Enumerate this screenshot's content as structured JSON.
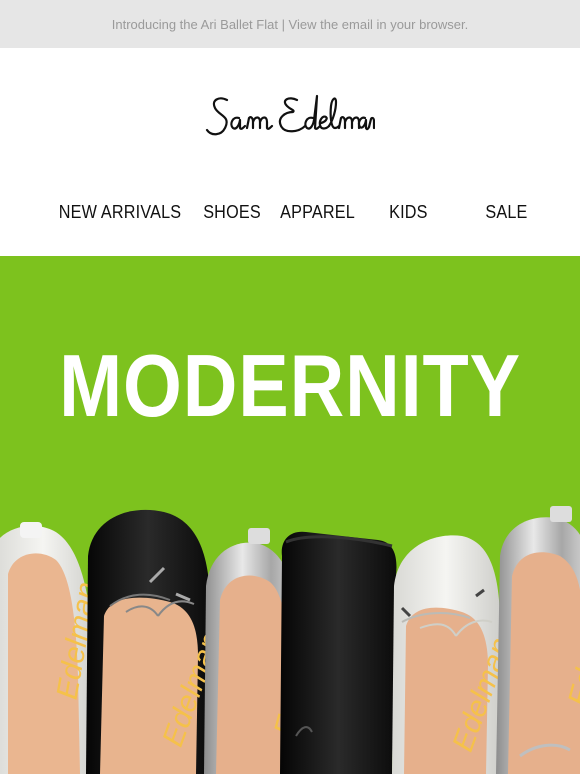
{
  "preheader": {
    "text": "Introducing the Ari Ballet Flat | View the email in your browser."
  },
  "logo": {
    "text": "Sam Edelman",
    "icon": "sam-edelman-signature-logo"
  },
  "nav": {
    "items": [
      {
        "label": "NEW ARRIVALS"
      },
      {
        "label": "SHOES"
      },
      {
        "label": "APPAREL"
      },
      {
        "label": "KIDS"
      },
      {
        "label": "SALE"
      }
    ]
  },
  "hero": {
    "title": "MODERNITY",
    "background": "#7dc21e",
    "image": "ballet-flats-lineup"
  }
}
